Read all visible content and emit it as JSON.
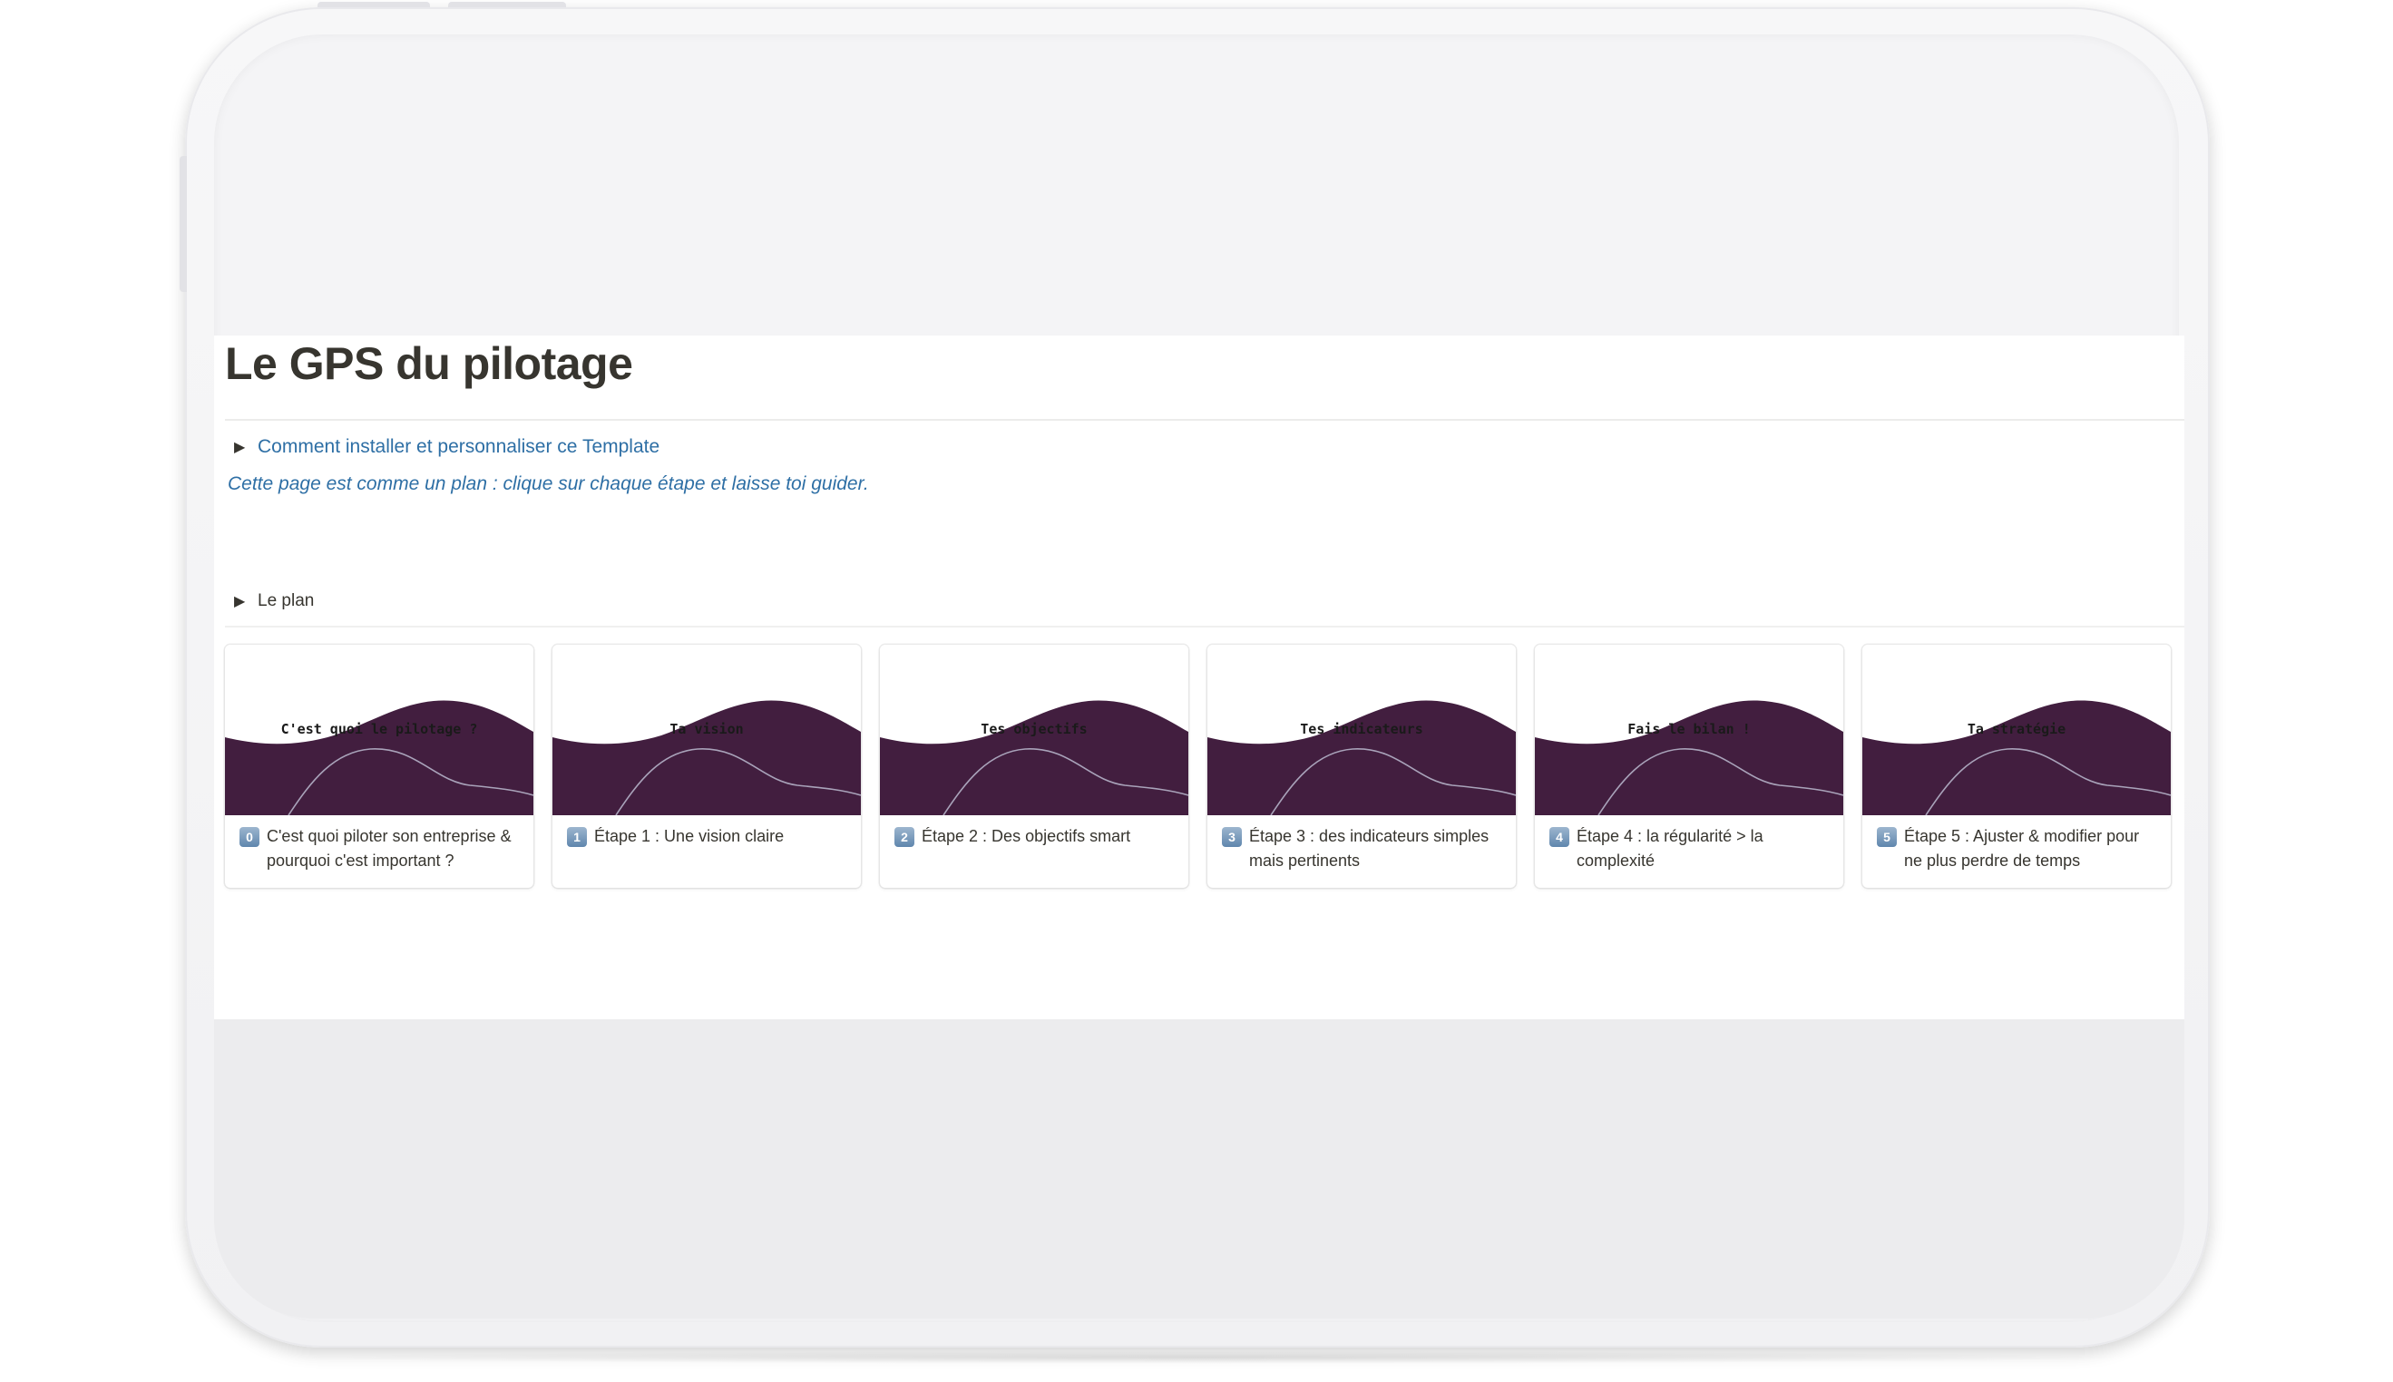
{
  "page": {
    "title": "Le GPS du pilotage",
    "install_toggle": "Comment installer et personnaliser ce Template",
    "note": "Cette page est comme un plan : clique sur chaque étape et laisse toi guider.",
    "plan_toggle": "Le plan",
    "toggle_arrow": "▶"
  },
  "colors": {
    "cover_wave": "#421e3f",
    "link_blue": "#2e6fa5",
    "text": "#37352f"
  },
  "cards": [
    {
      "cover_label": "C'est quoi le pilotage ?",
      "badge": "0",
      "title": "C'est quoi piloter son entreprise & pourquoi c'est important ?"
    },
    {
      "cover_label": "Ta vision",
      "badge": "1",
      "title": "Étape 1 : Une vision claire"
    },
    {
      "cover_label": "Tes objectifs",
      "badge": "2",
      "title": "Étape 2 : Des objectifs smart"
    },
    {
      "cover_label": "Tes indicateurs",
      "badge": "3",
      "title": "Étape 3 : des indicateurs simples mais pertinents"
    },
    {
      "cover_label": "Fais le bilan !",
      "badge": "4",
      "title": "Étape 4 : la régularité > la complexité"
    },
    {
      "cover_label": "Ta stratégie",
      "badge": "5",
      "title": "Étape 5 : Ajuster & modifier pour ne plus perdre de temps"
    }
  ]
}
